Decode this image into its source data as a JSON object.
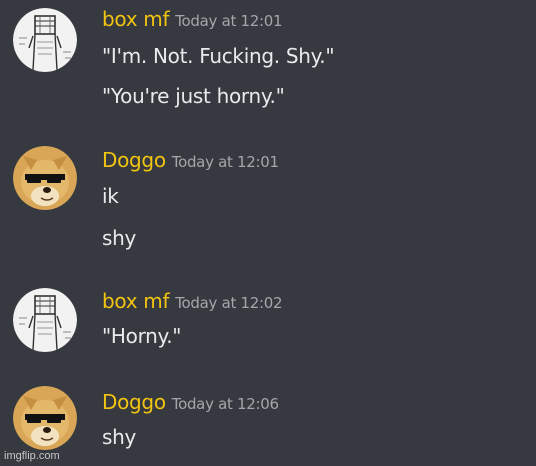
{
  "messages": [
    {
      "username": "box mf",
      "timestamp": "Today at 12:01",
      "avatar_icon": "box-head-sketch-avatar",
      "lines": [
        "\"I'm. Not. Fucking. Shy.\"",
        "\"You're just horny.\""
      ]
    },
    {
      "username": "Doggo",
      "timestamp": "Today at 12:01",
      "avatar_icon": "doge-sunglasses-avatar",
      "lines": [
        "ik",
        "shy"
      ]
    },
    {
      "username": "box mf",
      "timestamp": "Today at 12:02",
      "avatar_icon": "box-head-sketch-avatar",
      "lines": [
        "\"Horny.\""
      ]
    },
    {
      "username": "Doggo",
      "timestamp": "Today at 12:06",
      "avatar_icon": "doge-sunglasses-avatar",
      "lines": [
        "shy"
      ]
    }
  ],
  "watermark": "imgflip.com",
  "colors": {
    "background": "#36393f",
    "username": "#f1c40f",
    "timestamp": "#a3a6aa",
    "message_text": "#e9eaeb"
  }
}
